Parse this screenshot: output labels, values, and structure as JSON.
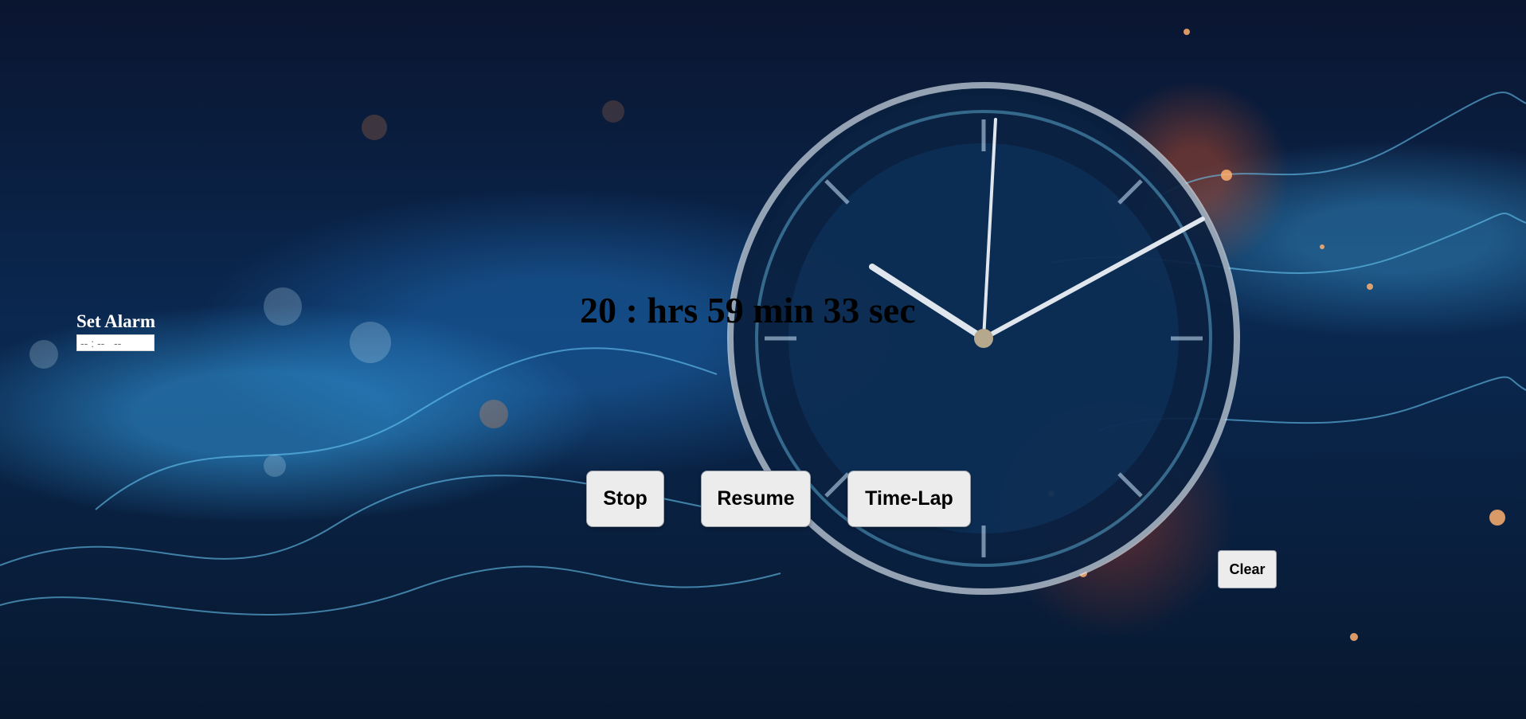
{
  "alarm": {
    "title": "Set Alarm",
    "input_placeholder": "-- : --   --"
  },
  "timer": {
    "display": "20 : hrs 59 min 33 sec"
  },
  "controls": {
    "stop_label": "Stop",
    "resume_label": "Resume",
    "timelap_label": "Time-Lap",
    "clear_label": "Clear"
  },
  "background": {
    "image_name": "clock-neural-network-background",
    "colors": {
      "deep_navy": "#0a1530",
      "electric_blue": "#3cb4ff",
      "ember_orange": "#ff5a1e"
    }
  }
}
